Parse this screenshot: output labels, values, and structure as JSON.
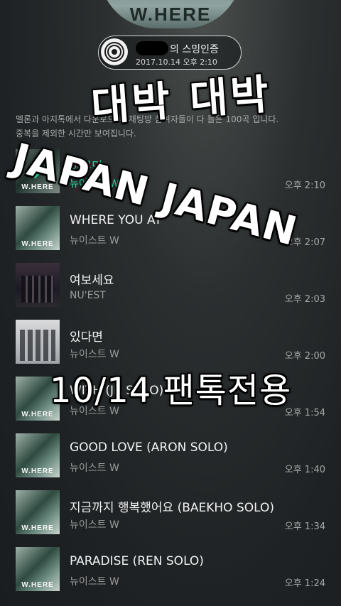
{
  "header": {
    "art_text": "W.HERE",
    "title_suffix": "의 스밍인증",
    "datetime": "2017.10.14 오후 2:10",
    "icon": "vinyl-disc-icon"
  },
  "notice": {
    "line1": "멜론과 아지톡에서 다운로드 후 채팅방 참여자들이 다 들은 100곡 입니다.",
    "line2": "중복을 제외한 시간만 보여집니다."
  },
  "tracks": [
    {
      "title": "하루만",
      "artist": "뉴이스트 W",
      "time": "오후 2:10",
      "playing": true,
      "art": "where"
    },
    {
      "title": "WHERE YOU AT",
      "artist": "뉴이스트 W",
      "time": "오후 2:07",
      "playing": false,
      "art": "where"
    },
    {
      "title": "여보세요",
      "artist": "NU'EST",
      "time": "오후 2:03",
      "playing": false,
      "art": "group"
    },
    {
      "title": "있다면",
      "artist": "뉴이스트 W",
      "time": "오후 2:00",
      "playing": false,
      "art": "light"
    },
    {
      "title": "WITH (JR SOLO)",
      "artist": "뉴이스트 W",
      "time": "오후 1:54",
      "playing": false,
      "art": "where"
    },
    {
      "title": "GOOD LOVE (ARON SOLO)",
      "artist": "뉴이스트 W",
      "time": "오후 1:40",
      "playing": false,
      "art": "where"
    },
    {
      "title": "지금까지 행복했어요 (BAEKHO SOLO)",
      "artist": "뉴이스트 W",
      "time": "오후 1:34",
      "playing": false,
      "art": "where"
    },
    {
      "title": "PARADISE (REN SOLO)",
      "artist": "뉴이스트 W",
      "time": "오후 1:24",
      "playing": false,
      "art": "where"
    }
  ],
  "overlay": {
    "line1": "대박 대박",
    "line2": "JAPAN JAPAN",
    "line3": "10/14 팬톡전용"
  },
  "colors": {
    "accent": "#2bd9a0",
    "background": "#1e2224"
  }
}
